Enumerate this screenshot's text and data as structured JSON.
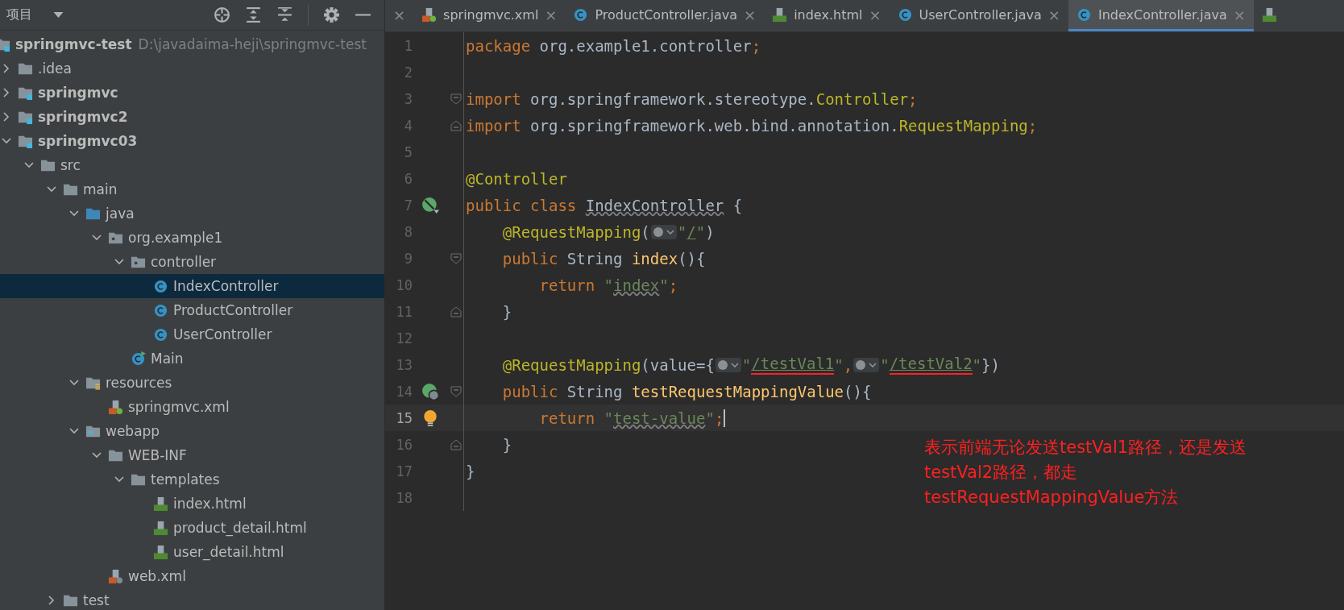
{
  "project_panel": {
    "title": "项目",
    "tree": [
      {
        "kind": "module",
        "label": "springmvc-test",
        "path": "D:\\javadaima-heji\\springmvc-test",
        "selected": false,
        "children": [
          {
            "kind": "folder",
            "label": ".idea",
            "expanded": false,
            "selected": false
          },
          {
            "kind": "module",
            "label": "springmvc",
            "expanded": false,
            "selected": false
          },
          {
            "kind": "module",
            "label": "springmvc2",
            "expanded": false,
            "selected": false
          },
          {
            "kind": "module",
            "label": "springmvc03",
            "expanded": true,
            "selected": false,
            "children": [
              {
                "kind": "folder",
                "label": "src",
                "expanded": true,
                "selected": false,
                "children": [
                  {
                    "kind": "folder",
                    "label": "main",
                    "expanded": true,
                    "selected": false,
                    "children": [
                      {
                        "kind": "source",
                        "label": "java",
                        "expanded": true,
                        "selected": false,
                        "children": [
                          {
                            "kind": "package",
                            "label": "org.example1",
                            "expanded": true,
                            "selected": false,
                            "children": [
                              {
                                "kind": "package",
                                "label": "controller",
                                "expanded": true,
                                "selected": false,
                                "children": [
                                  {
                                    "kind": "class",
                                    "label": "IndexController",
                                    "selected": true
                                  },
                                  {
                                    "kind": "class",
                                    "label": "ProductController",
                                    "selected": false
                                  },
                                  {
                                    "kind": "class",
                                    "label": "UserController",
                                    "selected": false
                                  }
                                ]
                              },
                              {
                                "kind": "main",
                                "label": "Main",
                                "selected": false
                              }
                            ]
                          }
                        ]
                      },
                      {
                        "kind": "resources",
                        "label": "resources",
                        "expanded": true,
                        "selected": false,
                        "children": [
                          {
                            "kind": "spring-xml",
                            "label": "springmvc.xml",
                            "selected": false
                          }
                        ]
                      },
                      {
                        "kind": "web",
                        "label": "webapp",
                        "expanded": true,
                        "selected": false,
                        "children": [
                          {
                            "kind": "folder",
                            "label": "WEB-INF",
                            "expanded": true,
                            "selected": false,
                            "children": [
                              {
                                "kind": "folder",
                                "label": "templates",
                                "expanded": true,
                                "selected": false,
                                "children": [
                                  {
                                    "kind": "html",
                                    "label": "index.html",
                                    "selected": false
                                  },
                                  {
                                    "kind": "html",
                                    "label": "product_detail.html",
                                    "selected": false
                                  },
                                  {
                                    "kind": "html",
                                    "label": "user_detail.html",
                                    "selected": false
                                  }
                                ]
                              }
                            ]
                          },
                          {
                            "kind": "web-xml",
                            "label": "web.xml",
                            "selected": false
                          }
                        ]
                      }
                    ]
                  },
                  {
                    "kind": "folder",
                    "label": "test",
                    "expanded": false,
                    "selected": false
                  }
                ]
              }
            ]
          }
        ]
      }
    ]
  },
  "tabs": [
    {
      "close": "×",
      "selected": false
    },
    {
      "kind": "spring-xml",
      "label": "springmvc.xml",
      "close": "×",
      "selected": false
    },
    {
      "kind": "class",
      "label": "ProductController.java",
      "close": "×",
      "selected": false
    },
    {
      "kind": "html",
      "label": "index.html",
      "close": "×",
      "selected": false
    },
    {
      "kind": "class",
      "label": "UserController.java",
      "close": "×",
      "selected": false
    },
    {
      "kind": "class",
      "label": "IndexController.java",
      "close": "×",
      "selected": true
    },
    {
      "kind": "html",
      "selected": false
    }
  ],
  "editor": {
    "lines": [
      {
        "number": "1",
        "tokens": [
          {
            "kind": "keyword",
            "text": "package "
          },
          {
            "kind": "plain",
            "text": "org.example1.controller"
          },
          {
            "kind": "keyword",
            "text": ";"
          }
        ]
      },
      {
        "number": "2"
      },
      {
        "number": "3",
        "fold_start": true,
        "tokens": [
          {
            "kind": "keyword",
            "text": "import "
          },
          {
            "kind": "plain",
            "text": "org.springframework.stereotype."
          },
          {
            "kind": "type",
            "text": "Controller"
          },
          {
            "kind": "keyword",
            "text": ";"
          }
        ]
      },
      {
        "number": "4",
        "fold_end": true,
        "tokens": [
          {
            "kind": "keyword",
            "text": "import "
          },
          {
            "kind": "plain",
            "text": "org.springframework.web.bind.annotation."
          },
          {
            "kind": "type",
            "text": "RequestMapping"
          },
          {
            "kind": "keyword",
            "text": ";"
          }
        ]
      },
      {
        "number": "5"
      },
      {
        "number": "6",
        "tokens": [
          {
            "kind": "annotation",
            "text": "@Controller"
          }
        ]
      },
      {
        "number": "7",
        "gutter": {
          "kind": "bean"
        },
        "tokens": [
          {
            "kind": "keyword",
            "text": "public class "
          },
          {
            "kind": "plain",
            "text": "IndexController",
            "wavy": true
          },
          {
            "kind": "plain",
            "text": " {"
          }
        ]
      },
      {
        "number": "8",
        "tokens": [
          {
            "kind": "annotation",
            "text": "    @RequestMapping"
          },
          {
            "kind": "plain",
            "text": "("
          },
          {
            "kind": "hint"
          },
          {
            "kind": "string",
            "text": "\""
          },
          {
            "kind": "link",
            "text": "/"
          },
          {
            "kind": "string",
            "text": "\""
          },
          {
            "kind": "plain",
            "text": ")"
          }
        ]
      },
      {
        "number": "9",
        "fold_start": true,
        "tokens": [
          {
            "kind": "keyword",
            "text": "    public "
          },
          {
            "kind": "plain",
            "text": "String "
          },
          {
            "kind": "method",
            "text": "index"
          },
          {
            "kind": "plain",
            "text": "(){"
          }
        ]
      },
      {
        "number": "10",
        "tokens": [
          {
            "kind": "keyword",
            "text": "        return "
          },
          {
            "kind": "string",
            "text": "\""
          },
          {
            "kind": "string",
            "text": "index",
            "wavy": true
          },
          {
            "kind": "string",
            "text": "\""
          },
          {
            "kind": "keyword",
            "text": ";"
          }
        ]
      },
      {
        "number": "11",
        "fold_end": true,
        "tokens": [
          {
            "kind": "plain",
            "text": "    }"
          }
        ]
      },
      {
        "number": "12"
      },
      {
        "number": "13",
        "tokens": [
          {
            "kind": "annotation",
            "text": "    @RequestMapping"
          },
          {
            "kind": "plain",
            "text": "(value={"
          },
          {
            "kind": "hint"
          },
          {
            "kind": "string",
            "text": "\""
          },
          {
            "kind": "link",
            "text": "/testVal1",
            "marked": true
          },
          {
            "kind": "string",
            "text": "\""
          },
          {
            "kind": "keyword",
            "text": ","
          },
          {
            "kind": "hint"
          },
          {
            "kind": "string",
            "text": "\""
          },
          {
            "kind": "link",
            "text": "/testVal2",
            "marked": true
          },
          {
            "kind": "string",
            "text": "\""
          },
          {
            "kind": "plain",
            "text": "})"
          }
        ]
      },
      {
        "number": "14",
        "gutter": {
          "kind": "web"
        },
        "fold_start": true,
        "tokens": [
          {
            "kind": "keyword",
            "text": "    public "
          },
          {
            "kind": "plain",
            "text": "String "
          },
          {
            "kind": "method",
            "text": "testRequestMappingValue"
          },
          {
            "kind": "plain",
            "text": "(){"
          }
        ]
      },
      {
        "number": "15",
        "gutter": {
          "kind": "bulb"
        },
        "current": true,
        "caret": true,
        "tokens": [
          {
            "kind": "keyword",
            "text": "        return "
          },
          {
            "kind": "string",
            "text": "\""
          },
          {
            "kind": "string",
            "text": "test-value",
            "wavy": true
          },
          {
            "kind": "string",
            "text": "\""
          },
          {
            "kind": "keyword",
            "text": ";"
          }
        ]
      },
      {
        "number": "16",
        "fold_end": true,
        "tokens": [
          {
            "kind": "plain",
            "text": "    }"
          }
        ]
      },
      {
        "number": "17",
        "tokens": [
          {
            "kind": "plain",
            "text": "}"
          }
        ]
      },
      {
        "number": "18"
      }
    ],
    "note": [
      "表示前端无论发送testVal1路径，还是发送",
      "testVal2路径，都走",
      "testRequestMappingValue方法"
    ]
  }
}
